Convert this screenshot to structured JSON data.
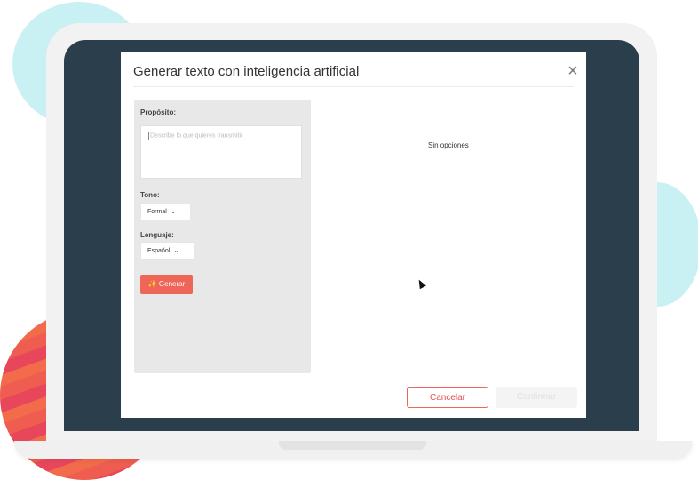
{
  "dialog": {
    "title": "Generar texto con inteligencia artificial",
    "close_symbol": "×"
  },
  "form": {
    "purpose_label": "Propósito:",
    "purpose_placeholder": "Describe lo que quieres transmitir",
    "tone_label": "Tono:",
    "tone_value": "Formal",
    "language_label": "Lenguaje:",
    "language_value": "Español",
    "generate_label": "Generar",
    "generate_icon": "magic-wand-icon"
  },
  "results": {
    "empty_text": "Sin opciones"
  },
  "footer": {
    "cancel_label": "Cancelar",
    "confirm_label": "Confirmar"
  },
  "colors": {
    "accent": "#ee6657",
    "screen": "#2b3e4c"
  }
}
